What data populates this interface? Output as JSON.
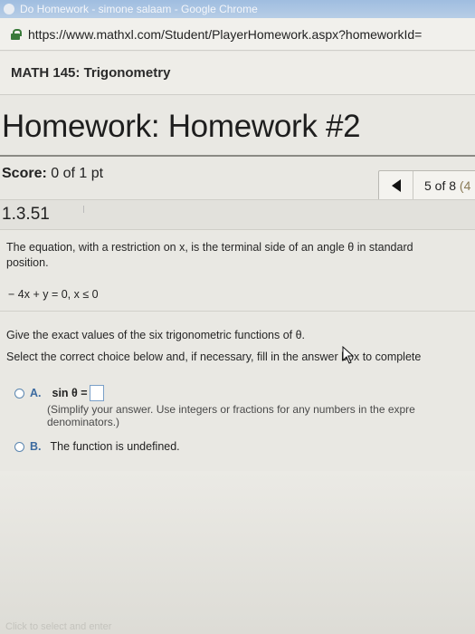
{
  "window": {
    "title": "Do Homework - simone salaam - Google Chrome"
  },
  "address_bar": {
    "url": "https://www.mathxl.com/Student/PlayerHomework.aspx?homeworkId="
  },
  "course": {
    "name": "MATH 145: Trigonometry"
  },
  "homework": {
    "title": "Homework: Homework #2",
    "score_label": "Score:",
    "score_value": "0 of 1 pt",
    "question_position": "5 of 8",
    "question_position_rest": "(4",
    "question_number": "1.3.51"
  },
  "question": {
    "line1": "The equation, with a restriction on x, is the terminal side of an angle θ in standard",
    "line2": "position.",
    "equation": "− 4x + y = 0, x ≤ 0",
    "instruction1": "Give the exact values of the six trigonometric functions of θ.",
    "instruction2": "Select the correct choice below and, if necessary, fill in the answer box to complete",
    "choice_a": {
      "letter": "A.",
      "label": "sin θ =",
      "note_line1": "(Simplify your answer. Use integers or fractions for any numbers in the expre",
      "note_line2": "denominators.)"
    },
    "choice_b": {
      "letter": "B.",
      "text": "The function is undefined."
    }
  },
  "footer": {
    "hint": "Click to select and enter"
  },
  "colors": {
    "accent": "#3b6aa0",
    "radio_border": "#5b86b0"
  }
}
